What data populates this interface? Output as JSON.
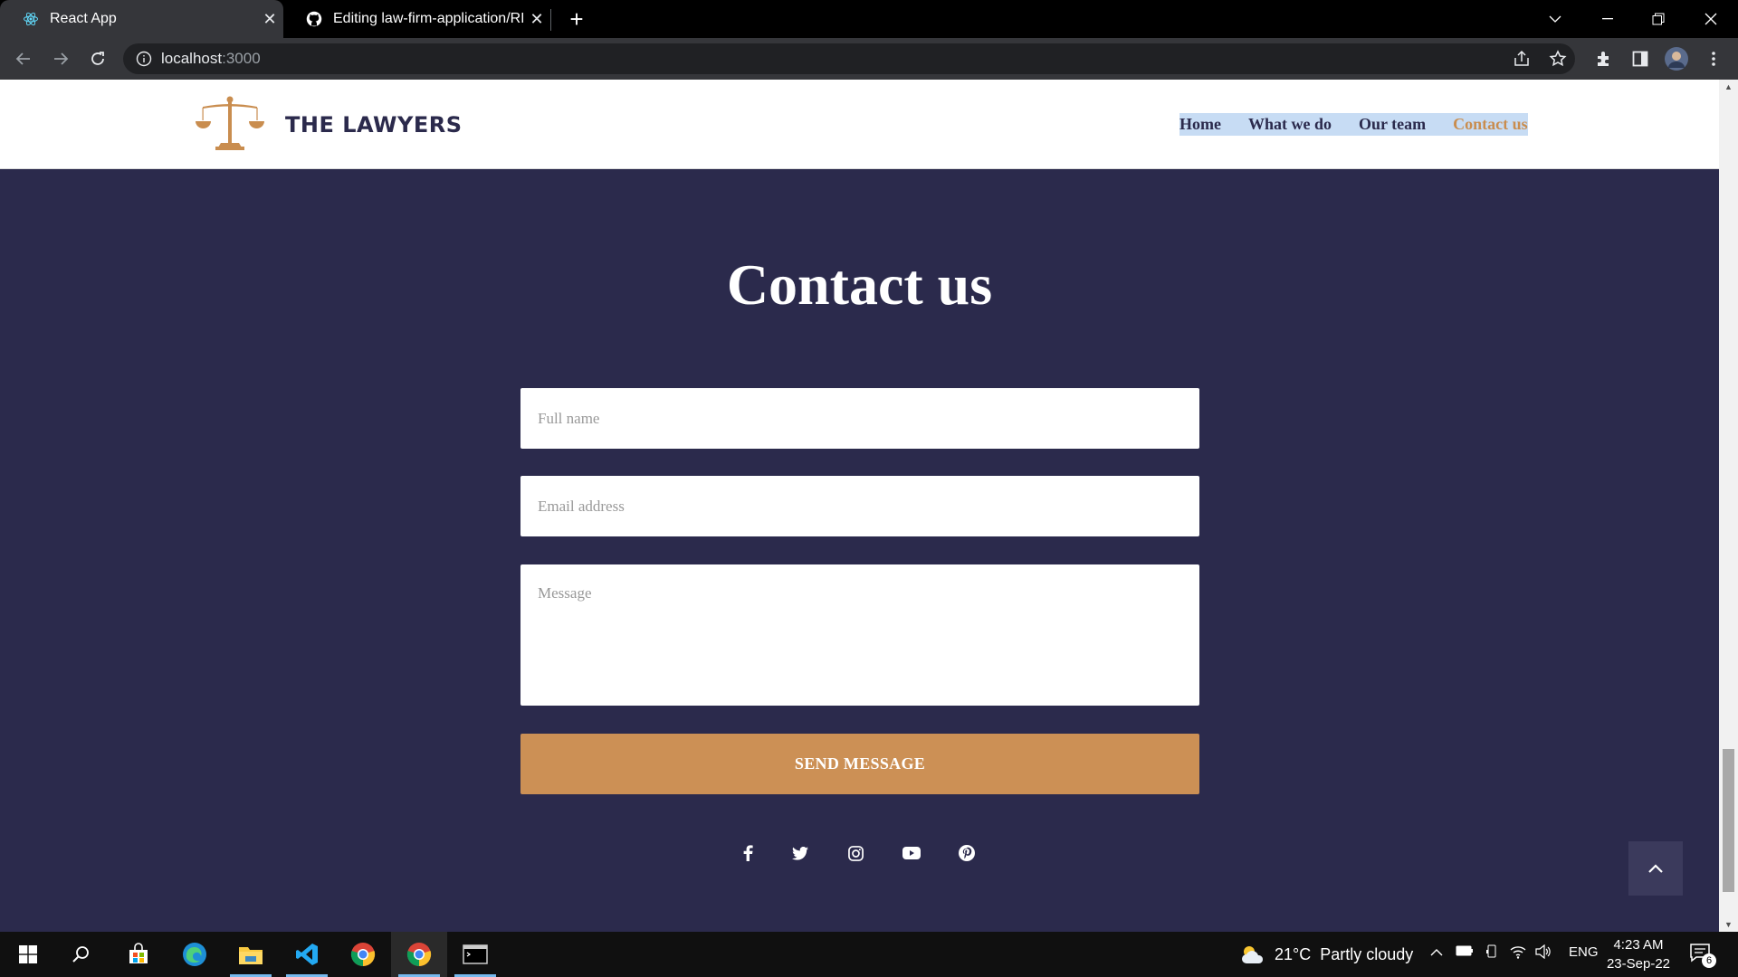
{
  "browser": {
    "tabs": [
      {
        "title": "React App",
        "icon": "react-icon"
      },
      {
        "title": "Editing law-firm-application/REA",
        "icon": "github-icon"
      }
    ],
    "url_host": "localhost",
    "url_port": ":3000"
  },
  "site": {
    "brand": "THE LAWYERS",
    "nav": [
      {
        "label": "Home"
      },
      {
        "label": "What we do"
      },
      {
        "label": "Our team"
      },
      {
        "label": "Contact us"
      }
    ]
  },
  "contact": {
    "title": "Contact us",
    "name_placeholder": "Full name",
    "email_placeholder": "Email address",
    "message_placeholder": "Message",
    "submit_label": "SEND MESSAGE"
  },
  "socials": [
    "facebook-icon",
    "twitter-icon",
    "instagram-icon",
    "youtube-icon",
    "pinterest-icon"
  ],
  "taskbar": {
    "weather_temp": "21°C",
    "weather_desc": "Partly cloudy",
    "language": "ENG",
    "time": "4:23 AM",
    "date": "23-Sep-22",
    "notification_count": "6"
  },
  "colors": {
    "page_bg": "#2b2a4c",
    "accent": "#cc9055",
    "nav_active": "#c98d4f"
  }
}
